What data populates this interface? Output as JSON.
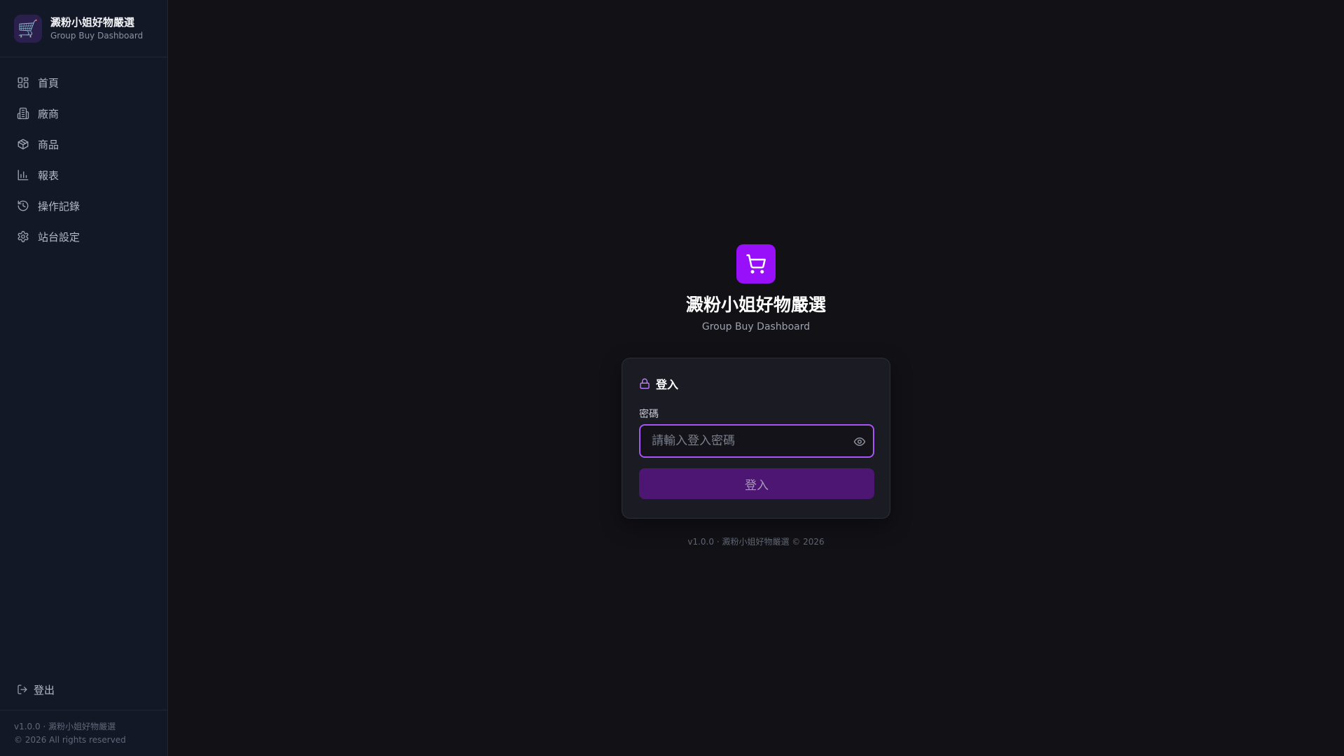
{
  "sidebar": {
    "brand": {
      "logo_emoji": "🛒",
      "title": "澱粉小姐好物嚴選",
      "subtitle": "Group Buy Dashboard"
    },
    "nav": [
      {
        "label": "首頁",
        "icon": "dashboard-icon"
      },
      {
        "label": "廠商",
        "icon": "building-icon"
      },
      {
        "label": "商品",
        "icon": "package-icon"
      },
      {
        "label": "報表",
        "icon": "bar-chart-icon"
      },
      {
        "label": "操作記錄",
        "icon": "history-icon"
      },
      {
        "label": "站台設定",
        "icon": "gear-icon"
      }
    ],
    "logout_label": "登出",
    "footer": {
      "version": "v1.0.0 · 澱粉小姐好物嚴選",
      "copyright": "© 2026 All rights reserved"
    }
  },
  "login": {
    "title": "澱粉小姐好物嚴選",
    "subtitle": "Group Buy Dashboard",
    "card_title": "登入",
    "password_label": "密碼",
    "password_placeholder": "請輸入登入密碼",
    "password_value": "",
    "submit_label": "登入",
    "version": "v1.0.0 · 澱粉小姐好物嚴選 © 2026"
  },
  "colors": {
    "accent": "#9810fa",
    "input_border": "#a855f7",
    "button_bg": "#4c1672",
    "sidebar_bg": "#131827",
    "main_bg": "#111116"
  }
}
